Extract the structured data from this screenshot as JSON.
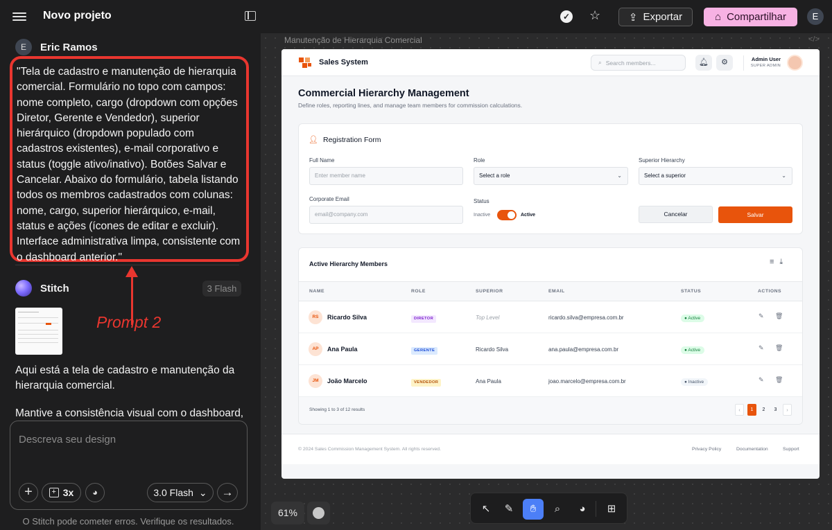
{
  "topbar": {
    "project_title": "Novo projeto",
    "export_label": "Exportar",
    "share_label": "Compartilhar",
    "avatar_initial": "E"
  },
  "chat": {
    "user_initial": "E",
    "user_name": "Eric Ramos",
    "prompt_text": "\"Tela de cadastro e manutenção de hierarquia comercial. Formulário no topo com campos: nome completo, cargo (dropdown com opções Diretor, Gerente e Vendedor), superior hierárquico (dropdown populado com cadastros existentes), e-mail corporativo e status (toggle ativo/inativo). Botões Salvar e Cancelar. Abaixo do formulário, tabela listando todos os membros cadastrados com colunas: nome, cargo, superior hierárquico, e-mail, status e ações (ícones de editar e excluir). Interface administrativa limpa, consistente com o dashboard anterior.\"",
    "annotation_label": "Prompt 2",
    "assistant_name": "Stitch",
    "assistant_badge": "3 Flash",
    "reply_paragraph_1": "Aqui está a tela de cadastro e manutenção da hierarquia comercial.",
    "reply_paragraph_2": "Mantive a consistência visual com o dashboard,",
    "composer_placeholder": "Descreva seu design",
    "variants_label": "3x",
    "model_label": "3.0 Flash",
    "disclaimer": "O Stitch pode cometer erros. Verifique os resultados."
  },
  "canvas": {
    "frame_label": "Manutenção de Hierarquia Comercial",
    "zoom_label": "61%",
    "tools": [
      "select-arrow-icon",
      "pencil-icon",
      "hand-icon",
      "search-icon",
      "palette-icon",
      "image-add-icon"
    ],
    "active_tool": "hand-icon"
  },
  "app": {
    "brand": "Sales System",
    "search_placeholder": "Search members...",
    "admin_name": "Admin User",
    "admin_role": "SUPER ADMIN",
    "page_title": "Commercial Hierarchy Management",
    "page_subtitle": "Define roles, reporting lines, and manage team members for commission calculations.",
    "form": {
      "title": "Registration Form",
      "full_name_label": "Full Name",
      "full_name_placeholder": "Enter member name",
      "role_label": "Role",
      "role_value": "Select a role",
      "superior_label": "Superior Hierarchy",
      "superior_value": "Select a superior",
      "email_label": "Corporate Email",
      "email_placeholder": "email@company.com",
      "status_label": "Status",
      "status_off": "Inactive",
      "status_on": "Active",
      "status_enabled": true,
      "cancel_label": "Cancelar",
      "save_label": "Salvar"
    },
    "table": {
      "title": "Active Hierarchy Members",
      "columns": [
        "NAME",
        "ROLE",
        "SUPERIOR",
        "EMAIL",
        "STATUS",
        "ACTIONS"
      ],
      "rows": [
        {
          "initials": "RS",
          "name": "Ricardo Silva",
          "role": "DIRETOR",
          "superior": "Top Level",
          "email": "ricardo.silva@empresa.com.br",
          "status": "Active"
        },
        {
          "initials": "AP",
          "name": "Ana Paula",
          "role": "GERENTE",
          "superior": "Ricardo Silva",
          "email": "ana.paula@empresa.com.br",
          "status": "Active"
        },
        {
          "initials": "JM",
          "name": "João Marcelo",
          "role": "VENDEDOR",
          "superior": "Ana Paula",
          "email": "joao.marcelo@empresa.com.br",
          "status": "Inactive"
        }
      ],
      "showing": "Showing 1 to 3 of 12 results",
      "pages": [
        "1",
        "2",
        "3"
      ],
      "current_page": "1"
    },
    "footer": {
      "copyright": "© 2024 Sales Commission Management System. All rights reserved.",
      "links": [
        "Privacy Policy",
        "Documentation",
        "Support"
      ]
    },
    "colors": {
      "accent": "#e8540c",
      "director_badge_bg": "#f3e8ff",
      "director_badge_fg": "#7e22ce",
      "manager_badge_bg": "#dbeafe",
      "manager_badge_fg": "#1d4ed8",
      "seller_badge_bg": "#fef3c7",
      "seller_badge_fg": "#b45309",
      "active_pill_bg": "#dcfce7",
      "active_pill_fg": "#15803d",
      "inactive_pill_bg": "#f1f5f9",
      "inactive_pill_fg": "#475569"
    }
  }
}
